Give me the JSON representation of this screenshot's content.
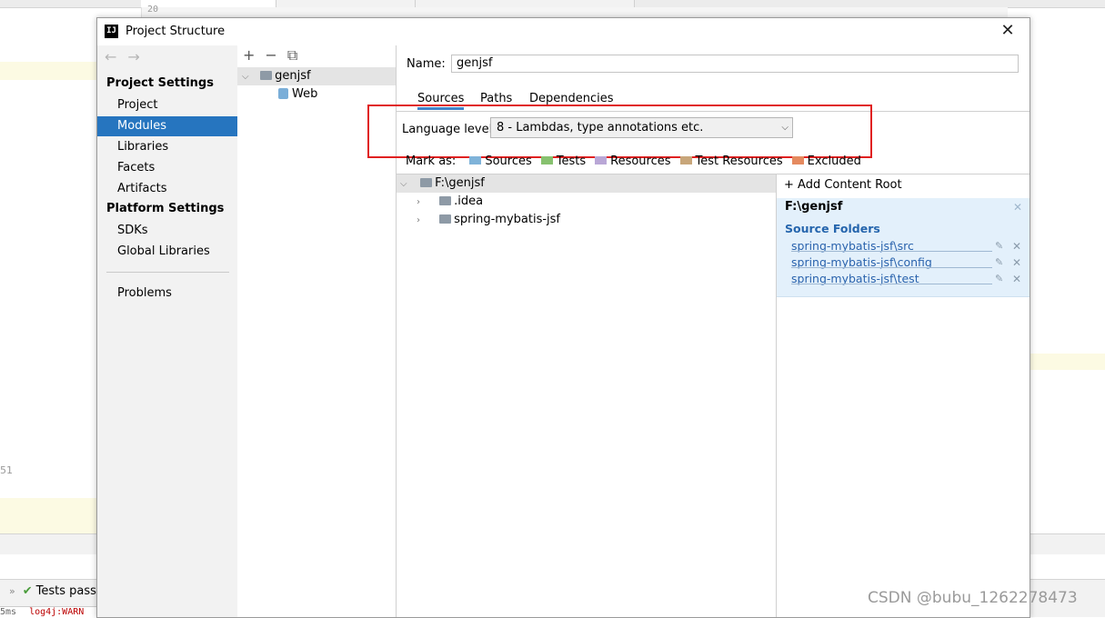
{
  "background": {
    "gutter_line": "20",
    "line_number": "51",
    "tests_status": "Tests pass",
    "log_time": "5ms",
    "log_text": "log4j:WARN",
    "watermark": "CSDN @bubu_1262278473"
  },
  "dialog": {
    "title": "Project Structure",
    "close_glyph": "✕",
    "app_icon_text": "IJ"
  },
  "sidebar": {
    "back_glyph": "←",
    "forward_glyph": "→",
    "project_settings_header": "Project Settings",
    "project_items": [
      {
        "label": "Project",
        "selected": false
      },
      {
        "label": "Modules",
        "selected": true
      },
      {
        "label": "Libraries",
        "selected": false
      },
      {
        "label": "Facets",
        "selected": false
      },
      {
        "label": "Artifacts",
        "selected": false
      }
    ],
    "platform_settings_header": "Platform Settings",
    "platform_items": [
      {
        "label": "SDKs"
      },
      {
        "label": "Global Libraries"
      }
    ],
    "problems_label": "Problems"
  },
  "modules": {
    "add_glyph": "+",
    "remove_glyph": "−",
    "copy_glyph": "⧉",
    "root_module": "genjsf",
    "facet": "Web"
  },
  "content": {
    "name_label": "Name:",
    "name_value": "genjsf",
    "tabs": [
      {
        "label": "Sources",
        "active": true
      },
      {
        "label": "Paths",
        "active": false
      },
      {
        "label": "Dependencies",
        "active": false
      }
    ],
    "language_level_label": "Language level:",
    "language_level_value": "8 - Lambdas, type annotations etc.",
    "mark_as_label": "Mark as:",
    "mark_as_options": [
      {
        "label": "Sources",
        "color": "#7fb3d9"
      },
      {
        "label": "Tests",
        "color": "#87c16f"
      },
      {
        "label": "Resources",
        "color": "#b9a7d6"
      },
      {
        "label": "Test Resources",
        "color": "#c8a67a"
      },
      {
        "label": "Excluded",
        "color": "#e58a5f"
      }
    ],
    "tree": {
      "root": "F:\\genjsf",
      "children": [
        ".idea",
        "spring-mybatis-jsf"
      ]
    },
    "roots_panel": {
      "add_content_root": "+ Add Content Root",
      "content_root": "F:\\genjsf",
      "source_folders_title": "Source Folders",
      "source_folders": [
        "spring-mybatis-jsf\\src",
        "spring-mybatis-jsf\\config",
        "spring-mybatis-jsf\\test"
      ]
    }
  },
  "colors": {
    "selection_blue": "#2675bf",
    "highlight_red": "#e02020",
    "source_blue": "#2a63ad"
  }
}
